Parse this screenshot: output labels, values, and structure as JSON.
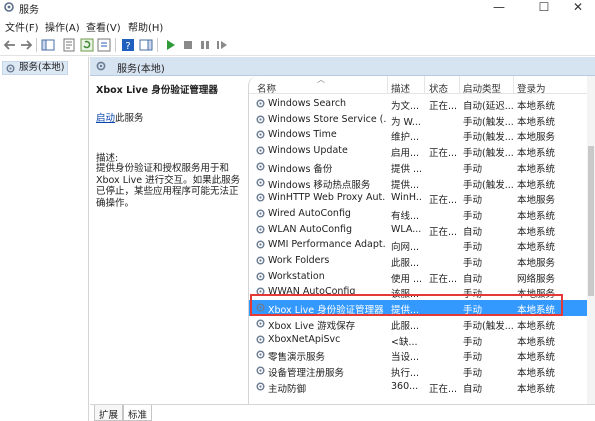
{
  "window": {
    "title": "服务",
    "min": "—",
    "max": "☐",
    "close": "✕"
  },
  "menu": [
    "文件(F)",
    "操作(A)",
    "查看(V)",
    "帮助(H)"
  ],
  "tree": {
    "root": "服务(本地)"
  },
  "header": {
    "title": "服务(本地)"
  },
  "details": {
    "title": "Xbox Live 身份验证管理器",
    "start_link": "启动",
    "start_suffix": "此服务",
    "desc_label": "描述:",
    "desc_text": "提供身份验证和授权服务用于和 Xbox Live 进行交互。如果此服务已停止，某些应用程序可能无法正确操作。"
  },
  "columns": {
    "name": "名称",
    "description": "描述",
    "status": "状态",
    "startup": "启动类型",
    "logon": "登录为"
  },
  "services": [
    {
      "name": "Windows Search",
      "description": "为文...",
      "status": "正在...",
      "startup": "自动(延迟...",
      "logon": "本地系统"
    },
    {
      "name": "Windows Store Service (...",
      "description": "为 W...",
      "status": "",
      "startup": "手动(触发...",
      "logon": "本地系统"
    },
    {
      "name": "Windows Time",
      "description": "维护...",
      "status": "",
      "startup": "手动(触发...",
      "logon": "本地服务"
    },
    {
      "name": "Windows Update",
      "description": "启用...",
      "status": "正在...",
      "startup": "手动(触发...",
      "logon": "本地系统"
    },
    {
      "name": "Windows 备份",
      "description": "提供 ...",
      "status": "",
      "startup": "手动",
      "logon": "本地系统"
    },
    {
      "name": "Windows 移动热点服务",
      "description": "提供...",
      "status": "",
      "startup": "手动(触发...",
      "logon": "本地系统"
    },
    {
      "name": "WinHTTP Web Proxy Aut...",
      "description": "WinH...",
      "status": "正在...",
      "startup": "手动",
      "logon": "本地服务"
    },
    {
      "name": "Wired AutoConfig",
      "description": "有线...",
      "status": "",
      "startup": "手动",
      "logon": "本地系统"
    },
    {
      "name": "WLAN AutoConfig",
      "description": "WLA...",
      "status": "正在...",
      "startup": "自动",
      "logon": "本地系统"
    },
    {
      "name": "WMI Performance Adapt...",
      "description": "向网...",
      "status": "",
      "startup": "手动",
      "logon": "本地系统"
    },
    {
      "name": "Work Folders",
      "description": "此服...",
      "status": "",
      "startup": "手动",
      "logon": "本地服务"
    },
    {
      "name": "Workstation",
      "description": "使用 ...",
      "status": "正在...",
      "startup": "自动",
      "logon": "网络服务"
    },
    {
      "name": "WWAN AutoConfig",
      "description": "该服...",
      "status": "",
      "startup": "手动",
      "logon": "本地服务"
    },
    {
      "name": "Xbox Live 身份验证管理器",
      "description": "提供...",
      "status": "",
      "startup": "手动",
      "logon": "本地系统"
    },
    {
      "name": "Xbox Live 游戏保存",
      "description": "此服...",
      "status": "",
      "startup": "手动(触发...",
      "logon": "本地系统"
    },
    {
      "name": "XboxNetApiSvc",
      "description": "<缺...",
      "status": "",
      "startup": "手动",
      "logon": "本地系统"
    },
    {
      "name": "零售演示服务",
      "description": "当设...",
      "status": "",
      "startup": "手动",
      "logon": "本地系统"
    },
    {
      "name": "设备管理注册服务",
      "description": "执行...",
      "status": "",
      "startup": "手动",
      "logon": "本地系统"
    },
    {
      "name": "主动防御",
      "description": "360...",
      "status": "正在...",
      "startup": "自动",
      "logon": "本地系统"
    }
  ],
  "selected_index": 13,
  "tabs": [
    "扩展",
    "标准"
  ],
  "colors": {
    "selection": "#3399ff",
    "highlight_border": "#e53935",
    "header_bg": "#d6e3f1"
  }
}
